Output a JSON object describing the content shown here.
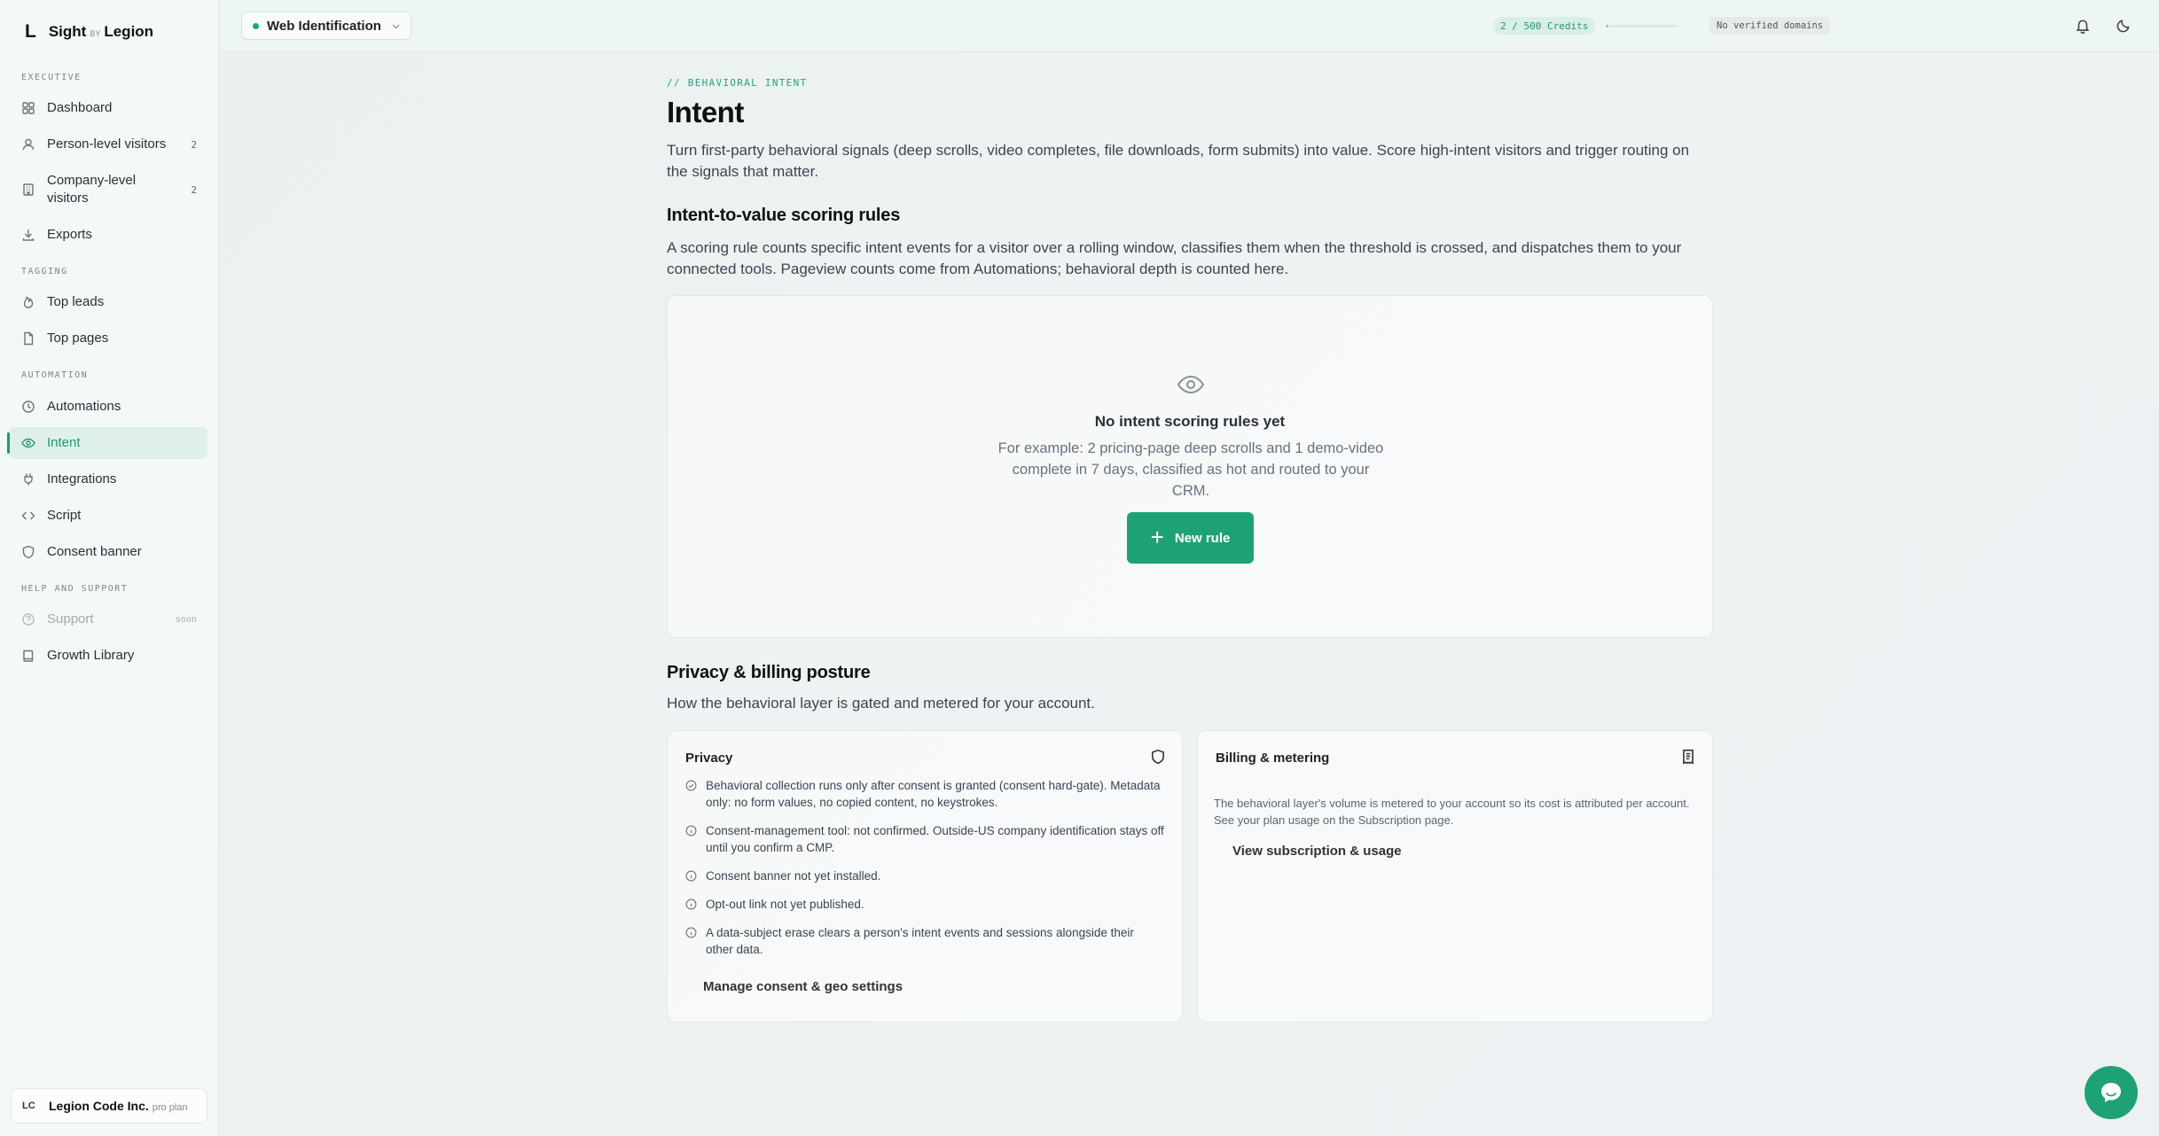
{
  "brand": {
    "mark": "L",
    "name_left": "Sight",
    "name_by": "BY",
    "name_right": "Legion"
  },
  "sidebar": {
    "sections": [
      {
        "label": "EXECUTIVE"
      },
      {
        "label": "TAGGING"
      },
      {
        "label": "AUTOMATION"
      },
      {
        "label": "HELP AND SUPPORT"
      }
    ],
    "items": [
      {
        "label": "Dashboard",
        "icon": "grid-icon"
      },
      {
        "label": "Person-level visitors",
        "count": "2",
        "icon": "user-icon"
      },
      {
        "label": "Company-level visitors",
        "count": "2",
        "icon": "building-icon"
      },
      {
        "label": "Exports",
        "icon": "download-icon"
      },
      {
        "label": "Top leads",
        "icon": "flame-icon"
      },
      {
        "label": "Top pages",
        "icon": "file-icon"
      },
      {
        "label": "Automations",
        "icon": "clock-icon"
      },
      {
        "label": "Intent",
        "icon": "eye-icon",
        "active": true
      },
      {
        "label": "Integrations",
        "icon": "plug-icon"
      },
      {
        "label": "Script",
        "icon": "code-icon"
      },
      {
        "label": "Consent banner",
        "icon": "shield-icon"
      },
      {
        "label": "Support",
        "badge": "soon",
        "icon": "help-icon",
        "disabled": true
      },
      {
        "label": "Growth Library",
        "icon": "book-icon"
      }
    ],
    "org": {
      "initials": "LC",
      "name": "Legion Code Inc.",
      "plan": "pro plan"
    }
  },
  "topbar": {
    "product": "Web Identification",
    "credits": "2 / 500 Credits",
    "credits_used_fraction": 0.004,
    "domains": "No verified domains"
  },
  "page": {
    "eyebrow": "// BEHAVIORAL INTENT",
    "title": "Intent",
    "lead": "Turn first-party behavioral signals (deep scrolls, video completes, file downloads, form submits) into value. Score high-intent visitors and trigger routing on the signals that matter.",
    "rules_title": "Intent-to-value scoring rules",
    "rules_desc": "A scoring rule counts specific intent events for a visitor over a rolling window, classifies them when the threshold is crossed, and dispatches them to your connected tools. Pageview counts come from Automations; behavioral depth is counted here.",
    "empty": {
      "title": "No intent scoring rules yet",
      "desc": "For example: 2 pricing-page deep scrolls and 1 demo-video complete in 7 days, classified as hot and routed to your CRM.",
      "button": "New rule"
    },
    "posture_title": "Privacy & billing posture",
    "posture_desc": "How the behavioral layer is gated and metered for your account.",
    "privacy": {
      "title": "Privacy",
      "items": [
        {
          "icon": "check-circle-icon",
          "text": "Behavioral collection runs only after consent is granted (consent hard-gate). Metadata only: no form values, no copied content, no keystrokes."
        },
        {
          "icon": "info-circle-icon",
          "text": "Consent-management tool: not confirmed. Outside-US company identification stays off until you confirm a CMP."
        },
        {
          "icon": "info-circle-icon",
          "text": "Consent banner not yet installed."
        },
        {
          "icon": "info-circle-icon",
          "text": "Opt-out link not yet published."
        },
        {
          "icon": "info-circle-icon",
          "text": "A data-subject erase clears a person's intent events and sessions alongside their other data."
        }
      ],
      "link": "Manage consent & geo settings"
    },
    "billing": {
      "title": "Billing & metering",
      "desc": "The behavioral layer's volume is metered to your account so its cost is attributed per account. See your plan usage on the Subscription page.",
      "link": "View subscription & usage"
    }
  },
  "colors": {
    "accent": "#1ea274",
    "accent_soft": "#dff0ea"
  }
}
